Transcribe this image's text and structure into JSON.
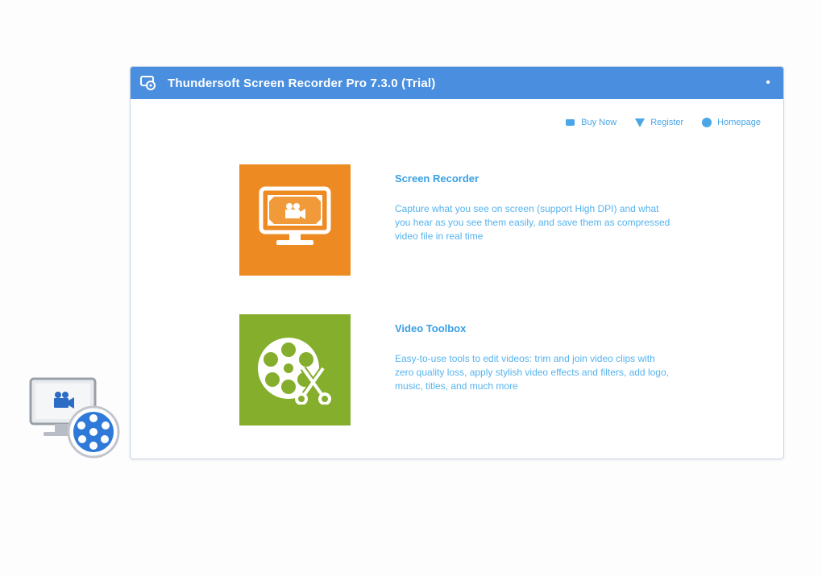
{
  "window": {
    "title": "Thundersoft Screen Recorder Pro 7.3.0 (Trial)",
    "menu_glyph": "•"
  },
  "toplinks": [
    {
      "label": "Buy Now",
      "icon": "cart-icon"
    },
    {
      "label": "Register",
      "icon": "key-icon"
    },
    {
      "label": "Homepage",
      "icon": "globe-icon"
    }
  ],
  "features": [
    {
      "title": "Screen Recorder",
      "description": "Capture what you see on screen (support High DPI) and what you hear as you see them easily, and save them as compressed video file in real time",
      "icon": "monitor-camera-icon",
      "tile_color": "#ee8a22"
    },
    {
      "title": "Video Toolbox",
      "description": "Easy-to-use tools to edit videos: trim and join video clips with zero quality loss, apply stylish video effects and filters, add logo, music, titles, and much more",
      "icon": "film-reel-scissors-icon",
      "tile_color": "#84ae2c"
    }
  ],
  "desktop_icon": {
    "icon": "screen-recorder-shortcut-icon"
  },
  "colors": {
    "titlebar": "#4a8fdf",
    "link": "#3aa0e4",
    "orange": "#ee8a22",
    "green": "#84ae2c"
  }
}
